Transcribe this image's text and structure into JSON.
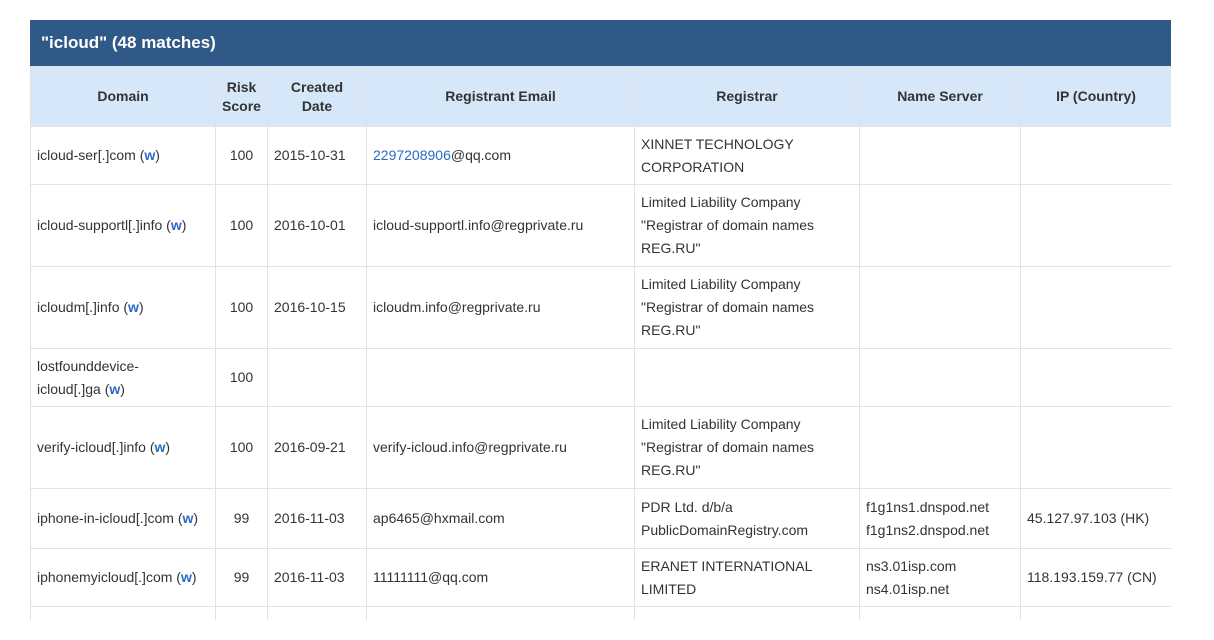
{
  "title": "\"icloud\" (48 matches)",
  "columns": {
    "domain": "Domain",
    "risk_line1": "Risk",
    "risk_line2": "Score",
    "created": "Created Date",
    "email": "Registrant Email",
    "registrar": "Registrar",
    "nameserver": "Name Server",
    "ip": "IP (Country)"
  },
  "whois_link": "w",
  "rows": [
    {
      "domain_l1": "icloud-ser[.]com (",
      "domain_l2": "",
      "risk": "100",
      "created": "2015-10-31",
      "email_prefix": "2297208906",
      "email_suffix": "@qq.com",
      "registrar_l1": "XINNET TECHNOLOGY",
      "registrar_l2": "CORPORATION",
      "registrar_l3": "",
      "ns1": "",
      "ns2": "",
      "ip": ""
    },
    {
      "domain_l1": "icloud-supportl[.]info (",
      "domain_l2": "",
      "risk": "100",
      "created": "2016-10-01",
      "email": "icloud-supportl.info@regprivate.ru",
      "registrar_l1": "Limited Liability Company",
      "registrar_l2": "\"Registrar of domain names",
      "registrar_l3": "REG.RU\"",
      "ns1": "",
      "ns2": "",
      "ip": ""
    },
    {
      "domain_l1": "icloudm[.]info (",
      "domain_l2": "",
      "risk": "100",
      "created": "2016-10-15",
      "email": "icloudm.info@regprivate.ru",
      "registrar_l1": "Limited Liability Company",
      "registrar_l2": "\"Registrar of domain names",
      "registrar_l3": "REG.RU\"",
      "ns1": "",
      "ns2": "",
      "ip": ""
    },
    {
      "domain_l1": "lostfounddevice-",
      "domain_l2": "icloud[.]ga (",
      "risk": "100",
      "created": "",
      "email": "",
      "registrar_l1": "",
      "registrar_l2": "",
      "registrar_l3": "",
      "ns1": "",
      "ns2": "",
      "ip": ""
    },
    {
      "domain_l1": "verify-icloud[.]info (",
      "domain_l2": "",
      "risk": "100",
      "created": "2016-09-21",
      "email": "verify-icloud.info@regprivate.ru",
      "registrar_l1": "Limited Liability Company",
      "registrar_l2": "\"Registrar of domain names",
      "registrar_l3": "REG.RU\"",
      "ns1": "",
      "ns2": "",
      "ip": ""
    },
    {
      "domain_l1": "iphone-in-icloud[.]com (",
      "domain_l2": "",
      "risk": "99",
      "created": "2016-11-03",
      "email": "ap6465@hxmail.com",
      "registrar_l1": "PDR Ltd. d/b/a",
      "registrar_l2": "PublicDomainRegistry.com",
      "registrar_l3": "",
      "ns1": "f1g1ns1.dnspod.net",
      "ns2": "f1g1ns2.dnspod.net",
      "ip": "45.127.97.103 (HK)"
    },
    {
      "domain_l1": "iphonemyicloud[.]com (",
      "domain_l2": "",
      "risk": "99",
      "created": "2016-11-03",
      "email": "11111111@qq.com",
      "registrar_l1": "ERANET INTERNATIONAL",
      "registrar_l2": "LIMITED",
      "registrar_l3": "",
      "ns1": "ns3.01isp.com",
      "ns2": "ns4.01isp.net",
      "ip": "118.193.159.77 (CN)"
    }
  ],
  "colors": {
    "title_bar": "#2f5a88",
    "header_bg": "#d5e7f8",
    "link": "#2a6ac4",
    "grid": "#e2e2e2"
  }
}
